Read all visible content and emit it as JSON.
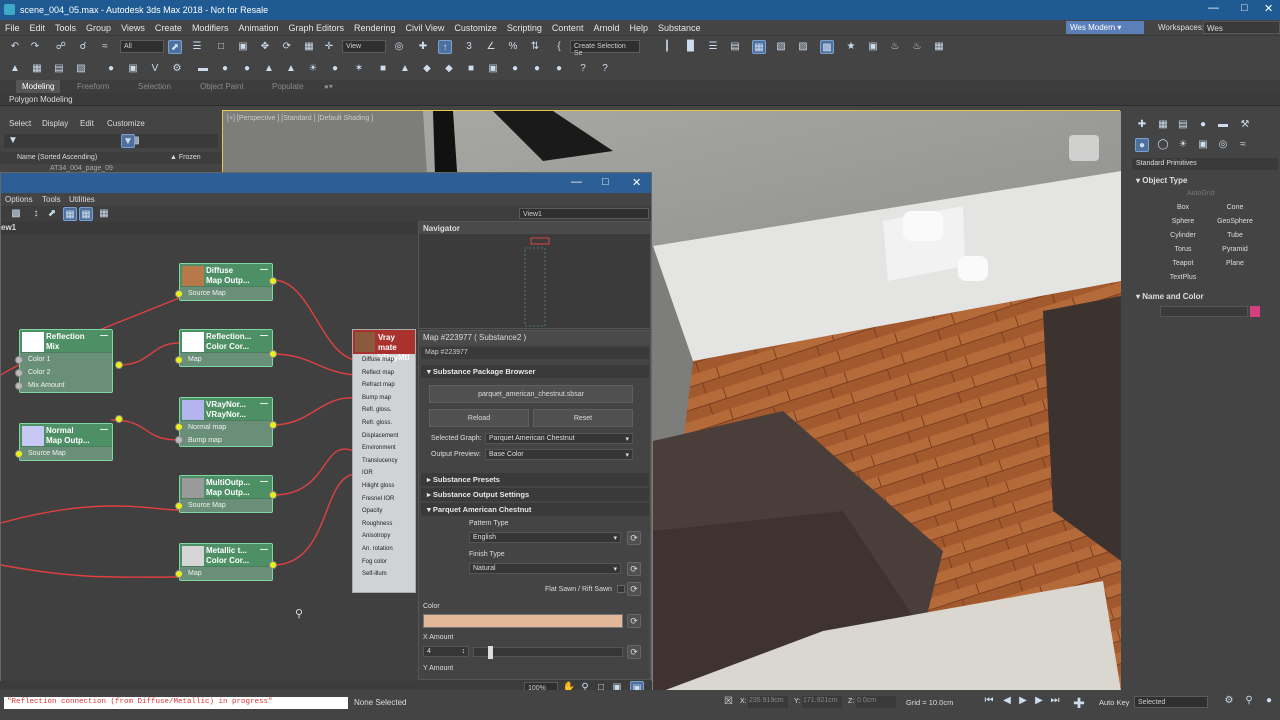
{
  "window": {
    "title": "scene_004_05.max - Autodesk 3ds Max 2018 - Not for Resale"
  },
  "menu": [
    "File",
    "Edit",
    "Tools",
    "Group",
    "Views",
    "Create",
    "Modifiers",
    "Animation",
    "Graph Editors",
    "Rendering",
    "Civil View",
    "Customize",
    "Scripting",
    "Content",
    "Arnold",
    "Help",
    "Substance"
  ],
  "menu_right": {
    "user": "Wes Modern",
    "workspaces_label": "Workspaces:",
    "workspace": "Wes"
  },
  "toolbar": {
    "filter": "All",
    "coord": "View",
    "create_selection": "Create Selection Se"
  },
  "ribbon": {
    "tabs": [
      "Modeling",
      "Freeform",
      "Selection",
      "Object Paint",
      "Populate"
    ],
    "polygon_modeling": "Polygon Modeling"
  },
  "scene_explorer": {
    "menu": [
      "Select",
      "Display",
      "Edit",
      "Customize"
    ],
    "name_header": "Name (Sorted Ascending)",
    "frozen_header": "▲ Frozen",
    "row": "AT34_004_page_09"
  },
  "viewport": {
    "label": "[+] [Perspective ] [Standard ] [Default Shading ]"
  },
  "command_panel": {
    "category": "Standard Primitives",
    "object_type": "Object Type",
    "autogrid": "AutoGrid",
    "buttons": [
      "Box",
      "Cone",
      "Sphere",
      "GeoSphere",
      "Cylinder",
      "Tube",
      "Torus",
      "Pyramid",
      "Teapot",
      "Plane",
      "TextPlus"
    ],
    "name_color": "Name and Color",
    "object_color": "#d63f7e"
  },
  "sme": {
    "menu": [
      "Options",
      "Tools",
      "Utilities"
    ],
    "view_dropdown": "View1",
    "view_tab": "ew1",
    "zoom": "100%",
    "nodes": {
      "diffuse": {
        "title1": "Diffuse",
        "title2": "Map Outp...",
        "slot": "Source Map"
      },
      "refl_cc": {
        "title1": "Reflection...",
        "title2": "Color Cor...",
        "slot": "Map"
      },
      "mix": {
        "title1": "Reflection",
        "title2": "Mix",
        "slots": [
          "Color 1",
          "Color 2",
          "Mix Amount"
        ]
      },
      "vraynormal": {
        "title1": "VRayNor...",
        "title2": "VRayNor...",
        "slots": [
          "Normal map",
          "Bump map"
        ]
      },
      "normal": {
        "title1": "Normal",
        "title2": "Map Outp...",
        "slot": "Source Map"
      },
      "multi": {
        "title1": "MultiOutp...",
        "title2": "Map Outp...",
        "slot": "Source Map"
      },
      "metallic": {
        "title1": "Metallic t...",
        "title2": "Color Cor...",
        "slot": "Map"
      }
    },
    "vray": {
      "title1": "Vray mate",
      "title2": "VRayMtl",
      "slots": [
        "Diffuse map",
        "Reflect map",
        "Refract map",
        "Bump map",
        "Refl. gloss.",
        "Refr. gloss.",
        "Displacement",
        "Environment",
        "Translucency",
        "IOR",
        "Hilight gloss",
        "Fresnel IOR",
        "Opacity",
        "Roughness",
        "Anisotropy",
        "An. rotation",
        "Fog color",
        "Self-illum"
      ]
    }
  },
  "navigator": {
    "title": "Navigator"
  },
  "params": {
    "title": "Map #223977  ( Substance2 )",
    "map_name": "Map #223977",
    "sections": [
      "Substance Package Browser",
      "Substance Presets",
      "Substance Output Settings",
      "Parquet American Chestnut"
    ],
    "package_file": "parquet_american_chestnut.sbsar",
    "reload": "Reload",
    "reset": "Reset",
    "selected_graph_label": "Selected Graph:",
    "selected_graph": "Parquet American Chestnut",
    "output_preview_label": "Output Preview:",
    "output_preview": "Base Color",
    "pattern_type_label": "Pattern Type",
    "pattern_type": "English",
    "finish_type_label": "Finish Type",
    "finish_type": "Natural",
    "flat_sawn_label": "Flat Sawn / Rift Sawn",
    "color_label": "Color",
    "color_value": "#e3b79a",
    "x_amount_label": "X Amount",
    "x_amount": "4",
    "y_amount_label": "Y Amount"
  },
  "status": {
    "script": "\"Reflection connection (from Diffuse/Metallic) in progress\"",
    "selection": "None Selected",
    "x": "235.919cm",
    "y": "171.921cm",
    "z": "0.0cm",
    "grid": "Grid = 10.0cm",
    "auto_key": "Auto Key",
    "selected_dd": "Selected"
  }
}
